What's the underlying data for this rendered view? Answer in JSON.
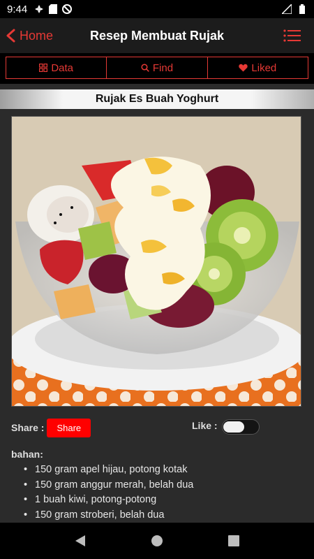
{
  "status_bar": {
    "time": "9:44"
  },
  "app_bar": {
    "home_label": "Home",
    "title": "Resep Membuat Rujak"
  },
  "tabs": [
    {
      "label": "Data",
      "icon": "grid-icon"
    },
    {
      "label": "Find",
      "icon": "search-icon"
    },
    {
      "label": "Liked",
      "icon": "heart-icon"
    }
  ],
  "recipe": {
    "title": "Rujak Es Buah Yoghurt",
    "share_label": "Share :",
    "share_button": "Share",
    "like_label": "Like :",
    "liked": false,
    "ingredients_title": "bahan:",
    "ingredients": [
      "150 gram apel hijau, potong kotak",
      "150 gram anggur merah, belah dua",
      "1 buah kiwi, potong-potong",
      "150 gram stroberi, belah dua"
    ]
  },
  "colors": {
    "accent": "#e53935",
    "share_button": "#ff0000",
    "background": "#2b2b2b"
  }
}
